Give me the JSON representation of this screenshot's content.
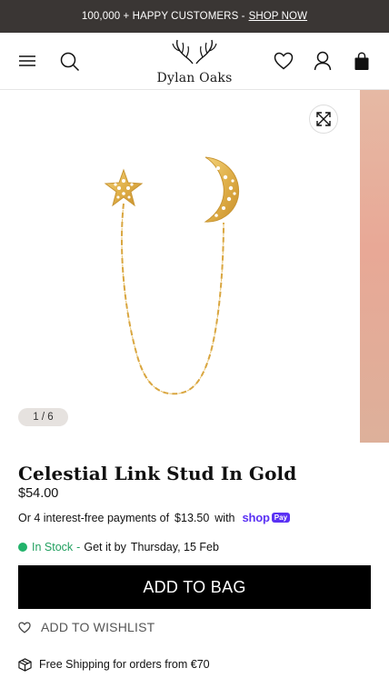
{
  "announcement": {
    "text": "100,000 + HAPPY CUSTOMERS -",
    "link": "SHOP NOW"
  },
  "header": {
    "logo_text": "Dylan Oaks",
    "icons": [
      "menu-icon",
      "search-icon",
      "wishlist-heart-icon",
      "account-icon",
      "bag-icon"
    ]
  },
  "gallery": {
    "counter": "1 / 6",
    "zoom_icon": "expand-icon"
  },
  "product": {
    "title": "Celestial Link Stud In Gold",
    "price": "$54.00",
    "installments": {
      "prefix": "Or 4 interest-free payments of",
      "amount": "$13.50",
      "suffix": "with",
      "provider": "shop",
      "provider_pill": "Pay"
    },
    "stock": {
      "status": "In Stock",
      "separator": "-",
      "get_it_by": "Get it by",
      "date": "Thursday, 15 Feb"
    },
    "add_to_bag": "ADD TO BAG",
    "wishlist": "ADD TO WISHLIST",
    "shipping": "Free Shipping for orders from €70"
  },
  "colors": {
    "announcement_bg": "#3a3634",
    "accent_stock": "#22b36b",
    "shop_pay": "#5a31f4",
    "button_bg": "#000000"
  }
}
